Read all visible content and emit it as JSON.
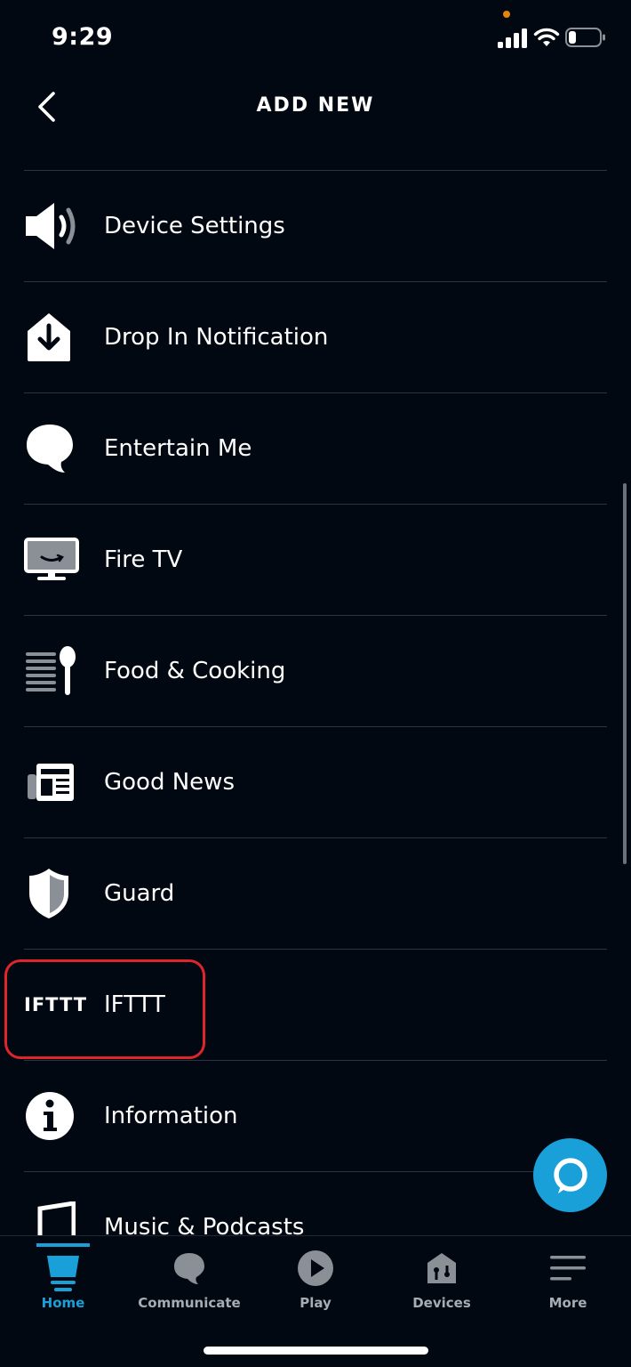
{
  "status_bar": {
    "time": "9:29",
    "privacy_dot_color": "#e3840c"
  },
  "header": {
    "title": "ADD NEW",
    "back_icon": "chevron-left-icon"
  },
  "list_items": [
    {
      "label": "Device Settings",
      "icon": "speaker-icon"
    },
    {
      "label": "Drop In Notification",
      "icon": "drop-in-icon"
    },
    {
      "label": "Entertain Me",
      "icon": "speech-bubble-icon"
    },
    {
      "label": "Fire TV",
      "icon": "tv-icon"
    },
    {
      "label": "Food & Cooking",
      "icon": "spoon-icon"
    },
    {
      "label": "Good News",
      "icon": "newspaper-icon"
    },
    {
      "label": "Guard",
      "icon": "shield-icon"
    },
    {
      "label": "IFTTT",
      "icon": "ifttt-logo",
      "logo_text": "IFTTT"
    },
    {
      "label": "Information",
      "icon": "info-icon"
    },
    {
      "label": "Music & Podcasts",
      "icon": "music-icon"
    }
  ],
  "tabs": [
    {
      "label": "Home",
      "icon": "home-icon",
      "active": true
    },
    {
      "label": "Communicate",
      "icon": "chat-icon",
      "active": false
    },
    {
      "label": "Play",
      "icon": "play-icon",
      "active": false
    },
    {
      "label": "Devices",
      "icon": "devices-icon",
      "active": false
    },
    {
      "label": "More",
      "icon": "menu-icon",
      "active": false
    }
  ],
  "colors": {
    "background": "#020812",
    "accent": "#1aa0d8",
    "alexa_button": "#1aa0d8",
    "highlight": "#e0242b",
    "divider": "#2b3440"
  }
}
